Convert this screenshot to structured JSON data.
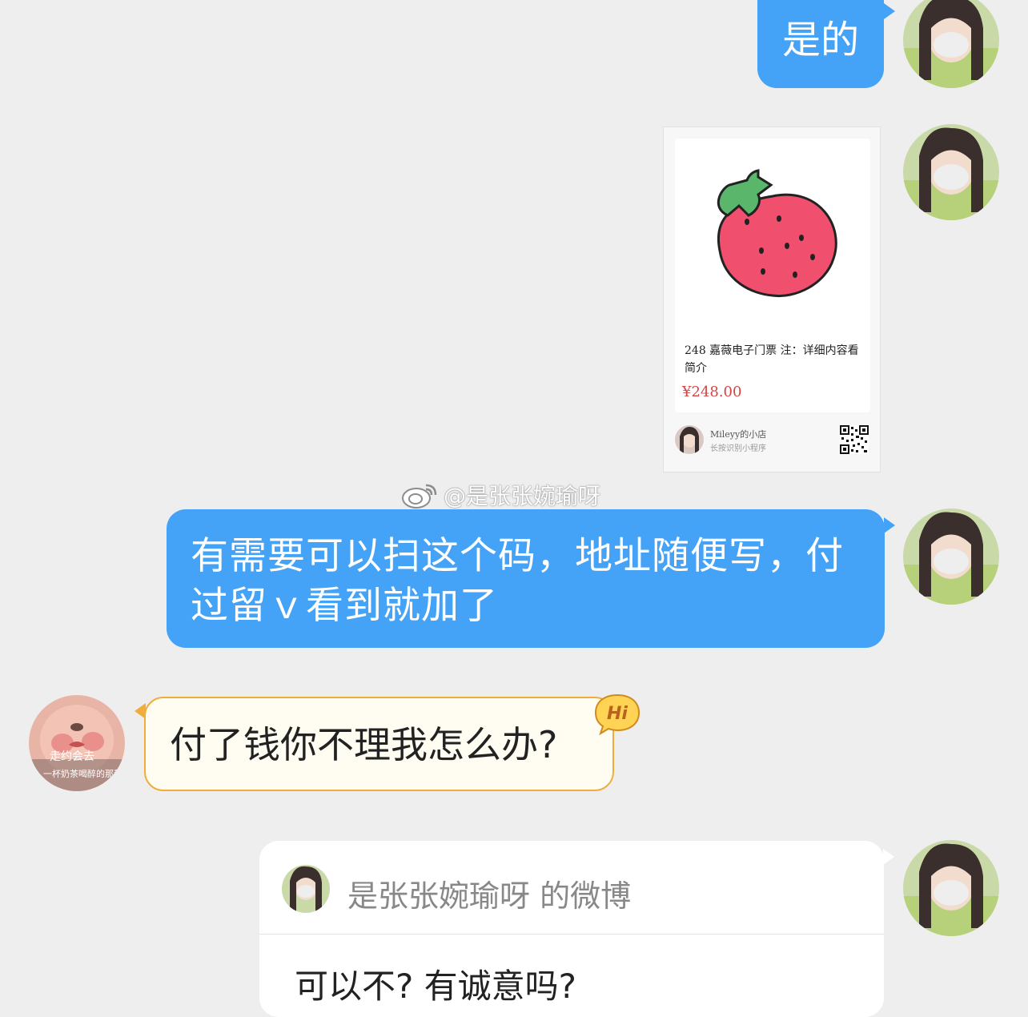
{
  "messages": {
    "reply_yes": "是的",
    "scan_code": "有需要可以扫这个码，地址随便写，付过留ｖ看到就加了",
    "question": "付了钱你不理我怎么办?",
    "hi_badge": "Hi"
  },
  "product_card": {
    "title": "248 嘉薇电子门票 注：详细内容看简介",
    "price": "¥248.00",
    "shop_name": "Mileyy的小店",
    "shop_hint": "长按识别小程序"
  },
  "watermark": {
    "text": "@是张张婉瑜呀"
  },
  "other_avatar": {
    "caption_line1": "走约会去",
    "caption_line2": "一杯奶茶喝醉的那种"
  },
  "share_card": {
    "title": "是张张婉瑜呀 的微博",
    "body": "可以不? 有诚意吗?"
  },
  "colors": {
    "blue_bubble": "#44a2f7",
    "other_bubble_border": "#efae3c",
    "price_red": "#d64545",
    "background": "#eeeeee"
  }
}
